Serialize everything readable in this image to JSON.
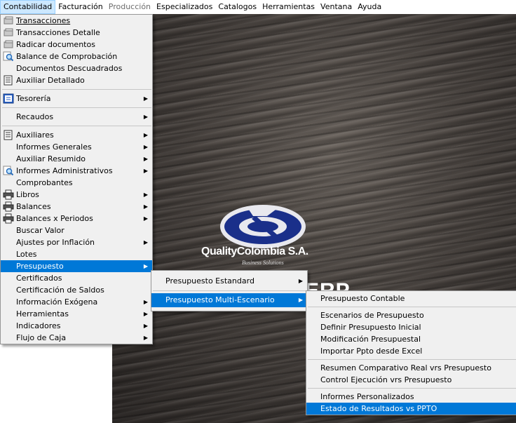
{
  "menubar": [
    {
      "label": "Contabilidad",
      "state": "active"
    },
    {
      "label": "Facturación",
      "state": "normal"
    },
    {
      "label": "Producción",
      "state": "disabled"
    },
    {
      "label": "Especializados",
      "state": "normal"
    },
    {
      "label": "Catalogos",
      "state": "normal"
    },
    {
      "label": "Herramientas",
      "state": "normal"
    },
    {
      "label": "Ventana",
      "state": "normal"
    },
    {
      "label": "Ayuda",
      "state": "normal"
    }
  ],
  "contabilidad_menu": {
    "items": [
      {
        "label": "Transacciones",
        "icon": "transactions-icon"
      },
      {
        "label": "Transacciones Detalle",
        "icon": "transactions-icon"
      },
      {
        "label": "Radicar documentos",
        "icon": "transactions-icon"
      },
      {
        "label": "Balance de Comprobación",
        "icon": "magnifier-icon"
      },
      {
        "label": "Documentos Descuadrados",
        "icon": ""
      },
      {
        "label": "Auxiliar Detallado",
        "icon": "ledger-icon"
      },
      {
        "label": "Tesorería",
        "icon": "treasury-icon",
        "submenu": true
      },
      {
        "label": "Recaudos",
        "submenu": true
      },
      {
        "label": "Auxiliares",
        "icon": "ledger-icon",
        "submenu": true
      },
      {
        "label": "Informes Generales",
        "submenu": true
      },
      {
        "label": "Auxiliar Resumido",
        "submenu": true
      },
      {
        "label": "Informes Administrativos",
        "icon": "magnifier-icon",
        "submenu": true
      },
      {
        "label": "Comprobantes"
      },
      {
        "label": "Libros",
        "icon": "printer-icon",
        "submenu": true
      },
      {
        "label": "Balances",
        "icon": "printer-icon",
        "submenu": true
      },
      {
        "label": "Balances x Periodos",
        "icon": "printer-icon",
        "submenu": true
      },
      {
        "label": "Buscar Valor"
      },
      {
        "label": "Ajustes por Inflación",
        "submenu": true
      },
      {
        "label": "Lotes"
      },
      {
        "label": "Presupuesto",
        "submenu": true,
        "highlighted": true
      },
      {
        "label": "Certificados"
      },
      {
        "label": "Certificación de Saldos"
      },
      {
        "label": "Información Exógena",
        "submenu": true
      },
      {
        "label": "Herramientas",
        "submenu": true
      },
      {
        "label": "Indicadores",
        "submenu": true
      },
      {
        "label": "Flujo de Caja",
        "submenu": true
      }
    ]
  },
  "presupuesto_menu": {
    "items": [
      {
        "label": "Presupuesto  Estandard",
        "submenu": true
      },
      {
        "label": "Presupuesto Multi-Escenario",
        "submenu": true,
        "highlighted": true
      }
    ]
  },
  "multiescenario_menu": {
    "items": [
      {
        "label": "Presupuesto Contable"
      },
      {
        "label": "Escenarios de Presupuesto"
      },
      {
        "label": "Definir Presupuesto Inicial"
      },
      {
        "label": "Modificación Presupuestal"
      },
      {
        "label": "Importar Ppto desde Excel"
      },
      {
        "label": "Resumen Comparativo  Real vrs Presupuesto"
      },
      {
        "label": "Control Ejecución vrs Presupuesto"
      },
      {
        "label": "Informes Personalizados"
      },
      {
        "label": "Estado de Resultados vs PPTO",
        "highlighted": true
      }
    ]
  },
  "background": {
    "logo_text": "QualityColombia S.A.",
    "logo_subtext": "Business Solutions",
    "brand_text": "ERP"
  },
  "colors": {
    "highlight": "#0078d7",
    "menu_bg": "#f0f0f0",
    "menubar_active": "#cce8ff"
  }
}
